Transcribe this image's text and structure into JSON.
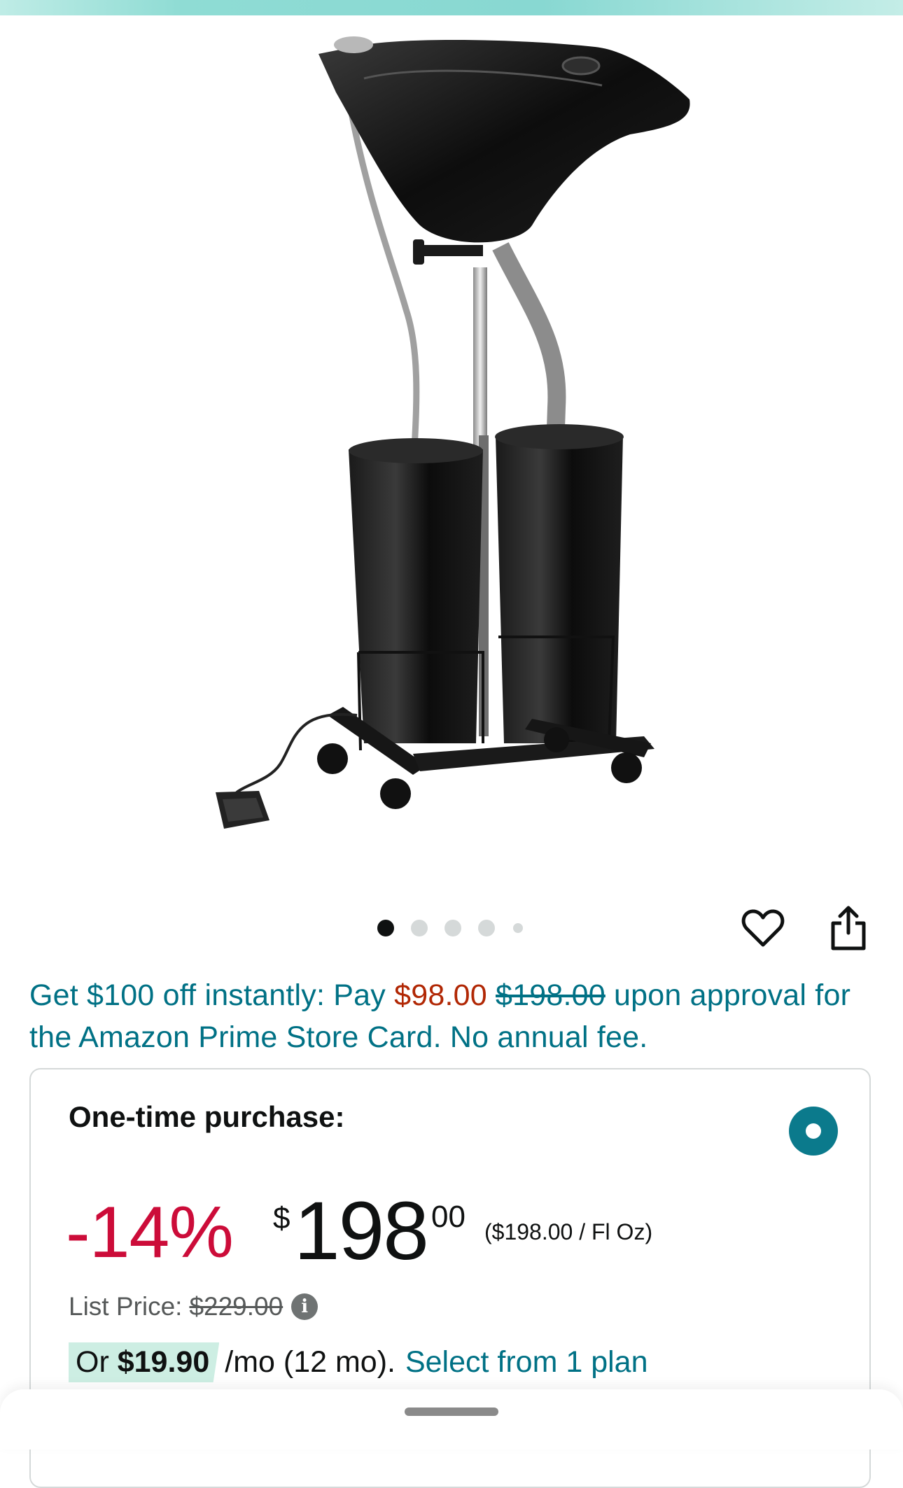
{
  "product": {
    "image_alt": "Portable shampoo bowl with two water tanks, hose and foot pump",
    "carousel": {
      "total": 5,
      "active": 0
    }
  },
  "icons": {
    "wishlist": "heart-outline-icon",
    "share": "share-icon",
    "info": "info-icon"
  },
  "promo": {
    "prefix": "Get $100 off instantly: Pay ",
    "new_price": "$98.00",
    "old_price": "$198.00",
    "suffix": " upon approval for the Amazon Prime Store Card. No annual fee."
  },
  "purchase_option": {
    "title": "One-time purchase:",
    "selected": true,
    "discount": "-14%",
    "currency_symbol": "$",
    "price_whole": "198",
    "price_fraction": "00",
    "unit_price": "($198.00 / Fl Oz)",
    "list_price_label": "List Price:",
    "list_price": "$229.00",
    "monthly_or": "Or ",
    "monthly_amount": "$19.90",
    "monthly_terms": "/mo (12 mo).",
    "monthly_link": "Select from 1 plan"
  },
  "colors": {
    "link": "#007185",
    "discount": "#cc0c39",
    "promo_price": "#b12704",
    "radio_selected": "#0b7a8c",
    "monthly_highlight": "#cdeee3"
  }
}
